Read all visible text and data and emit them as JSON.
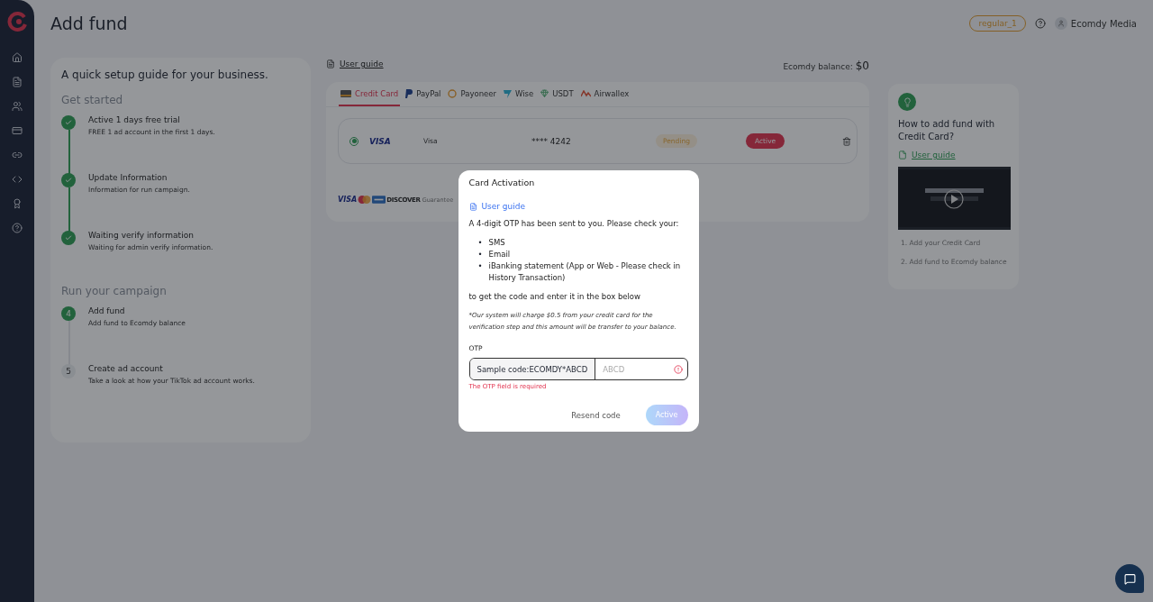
{
  "header": {
    "title": "Add fund",
    "badge": "regular_1",
    "user": "Ecomdy Media"
  },
  "guide": {
    "title": "A quick setup guide for your business.",
    "sections": [
      {
        "heading": "Get started",
        "steps": [
          {
            "kind": "done",
            "title": "Active 1 days free trial",
            "text": "FREE 1 ad account in the first 1 days."
          },
          {
            "kind": "done",
            "title": "Update Information",
            "text": "Information for run campaign."
          },
          {
            "kind": "done",
            "title": "Waiting verify information",
            "text": "Waiting for admin verify information."
          }
        ]
      },
      {
        "heading": "Run your campaign",
        "steps": [
          {
            "kind": "current",
            "number": "4",
            "title": "Add fund",
            "text": "Add fund to Ecomdy balance"
          },
          {
            "kind": "todo",
            "number": "5",
            "title": "Create ad account",
            "text": "Take a look at how your TikTok ad account works."
          }
        ]
      }
    ]
  },
  "funding": {
    "user_guide": "User guide",
    "balance_label": "Ecomdy balance:",
    "balance": "$0",
    "tabs": [
      {
        "label": "Credit Card",
        "selected": true
      },
      {
        "label": "PayPal",
        "selected": false
      },
      {
        "label": "Payoneer",
        "selected": false
      },
      {
        "label": "Wise",
        "selected": false
      },
      {
        "label": "USDT",
        "selected": false
      },
      {
        "label": "Airwallex",
        "selected": false
      }
    ],
    "cards": [
      {
        "selected": true,
        "brand": "VISA",
        "name": "Visa",
        "number": "**** 4242",
        "status": "Pending",
        "action": "Active"
      }
    ],
    "logos": {
      "visa": "VISA",
      "discover": "DISCOVER",
      "note": "Guarantee"
    }
  },
  "help": {
    "title": "How to add fund with Credit Card?",
    "link": "User guide",
    "video": {
      "kind": "picture"
    },
    "steps": [
      "1. Add your Credit Card",
      "2. Add fund to Ecomdy balance"
    ]
  },
  "modal": {
    "title": "Card Activation",
    "link": "User guide",
    "intro": "A 4-digit OTP has been sent to you. Please check your:",
    "channels": [
      {
        "marker": "•",
        "text": "SMS"
      },
      {
        "marker": "•",
        "text": "Email"
      },
      {
        "marker": "•",
        "text": "iBanking statement (App or Web - Please check in History Transaction)"
      }
    ],
    "instruction": "to get the code and enter it in the box below",
    "note": "*Our system will charge $0.5 from your credit card for the verification step and this amount will be transfer to your balance.",
    "otp_label": "OTP",
    "prefix": "Sample code:ECOMDY*ABCD",
    "placeholder": "ABCD",
    "error": "The OTP field is required",
    "resend": "Resend code",
    "submit": {
      "label": "Active",
      "disabled": true
    }
  }
}
